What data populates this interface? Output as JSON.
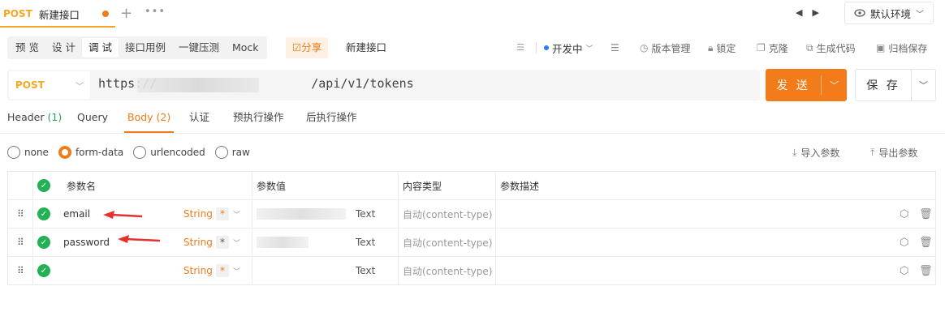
{
  "tab": {
    "method": "POST",
    "title": "新建接口"
  },
  "env": {
    "label": "默认环境"
  },
  "modes": [
    "预 览",
    "设 计",
    "调 试",
    "接口用例",
    "一键压测",
    "Mock"
  ],
  "active_mode": 2,
  "toolbar": {
    "share_label": "☑分享",
    "api_name": "新建接口",
    "status_label": "开发中",
    "actions": [
      "版本管理",
      "锁定",
      "克隆",
      "生成代码",
      "归档保存"
    ]
  },
  "request": {
    "method": "POST",
    "url_prefix": "https://",
    "url_suffix": "/api/v1/tokens",
    "send_label": "发 送",
    "save_label": "保 存"
  },
  "req_tabs": [
    {
      "label": "Header",
      "count": "(1)"
    },
    {
      "label": "Query",
      "count": ""
    },
    {
      "label": "Body",
      "count": "(2)"
    },
    {
      "label": "认证",
      "count": ""
    },
    {
      "label": "预执行操作",
      "count": ""
    },
    {
      "label": "后执行操作",
      "count": ""
    }
  ],
  "active_req_tab": 2,
  "body_types": [
    "none",
    "form-data",
    "urlencoded",
    "raw"
  ],
  "active_body_type": 1,
  "import_label": "导入参数",
  "export_label": "导出参数",
  "table": {
    "headers": {
      "name": "参数名",
      "value": "参数值",
      "content_type": "内容类型",
      "desc": "参数描述"
    },
    "rows": [
      {
        "name": "email",
        "type": "String",
        "required": true,
        "value_type": "Text",
        "content_type": "自动(content-type)"
      },
      {
        "name": "password",
        "type": "String",
        "required": false,
        "value_type": "Text",
        "content_type": "自动(content-type)"
      },
      {
        "name": "",
        "type": "String",
        "required": true,
        "value_type": "Text",
        "content_type": "自动(content-type)"
      }
    ]
  },
  "colors": {
    "accent": "#f27b1a",
    "method": "#f5a623",
    "check": "#22b255",
    "annotation": "#e5322d"
  }
}
